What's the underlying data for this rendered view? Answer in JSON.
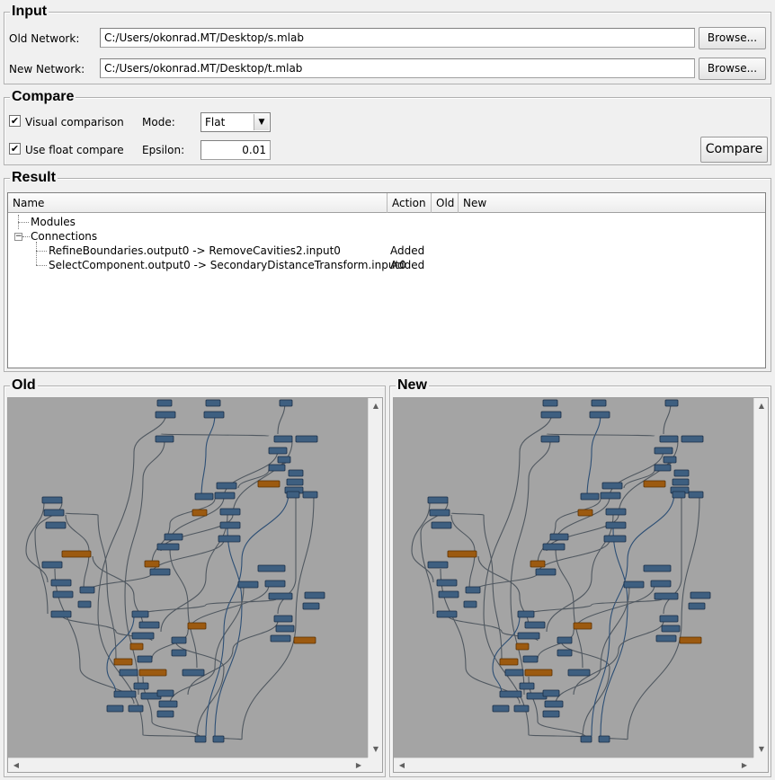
{
  "input": {
    "title": "Input",
    "old_label": "Old Network:",
    "old_value": "C:/Users/okonrad.MT/Desktop/s.mlab",
    "new_label": "New Network:",
    "new_value": "C:/Users/okonrad.MT/Desktop/t.mlab",
    "browse_label": "Browse..."
  },
  "compare": {
    "title": "Compare",
    "visual_label": "Visual comparison",
    "visual_checked": true,
    "float_label": "Use float compare",
    "float_checked": true,
    "mode_label": "Mode:",
    "mode_value": "Flat",
    "epsilon_label": "Epsilon:",
    "epsilon_value": "0.01",
    "compare_button": "Compare"
  },
  "result": {
    "title": "Result",
    "columns": [
      "Name",
      "Action",
      "Old",
      "New"
    ],
    "rows": [
      {
        "name": "Modules",
        "action": ""
      },
      {
        "name": "Connections",
        "action": ""
      },
      {
        "name": "RefineBoundaries.output0 -> RemoveCavities2.input0",
        "action": "Added"
      },
      {
        "name": "SelectComponent.output0 -> SecondaryDistanceTransform.input0",
        "action": "Added"
      }
    ]
  },
  "old_panel": {
    "title": "Old"
  },
  "new_panel": {
    "title": "New"
  },
  "colors": {
    "module": "#3e5f80",
    "module_highlight": "#9c5a10",
    "canvas": "#a4a4a4"
  }
}
